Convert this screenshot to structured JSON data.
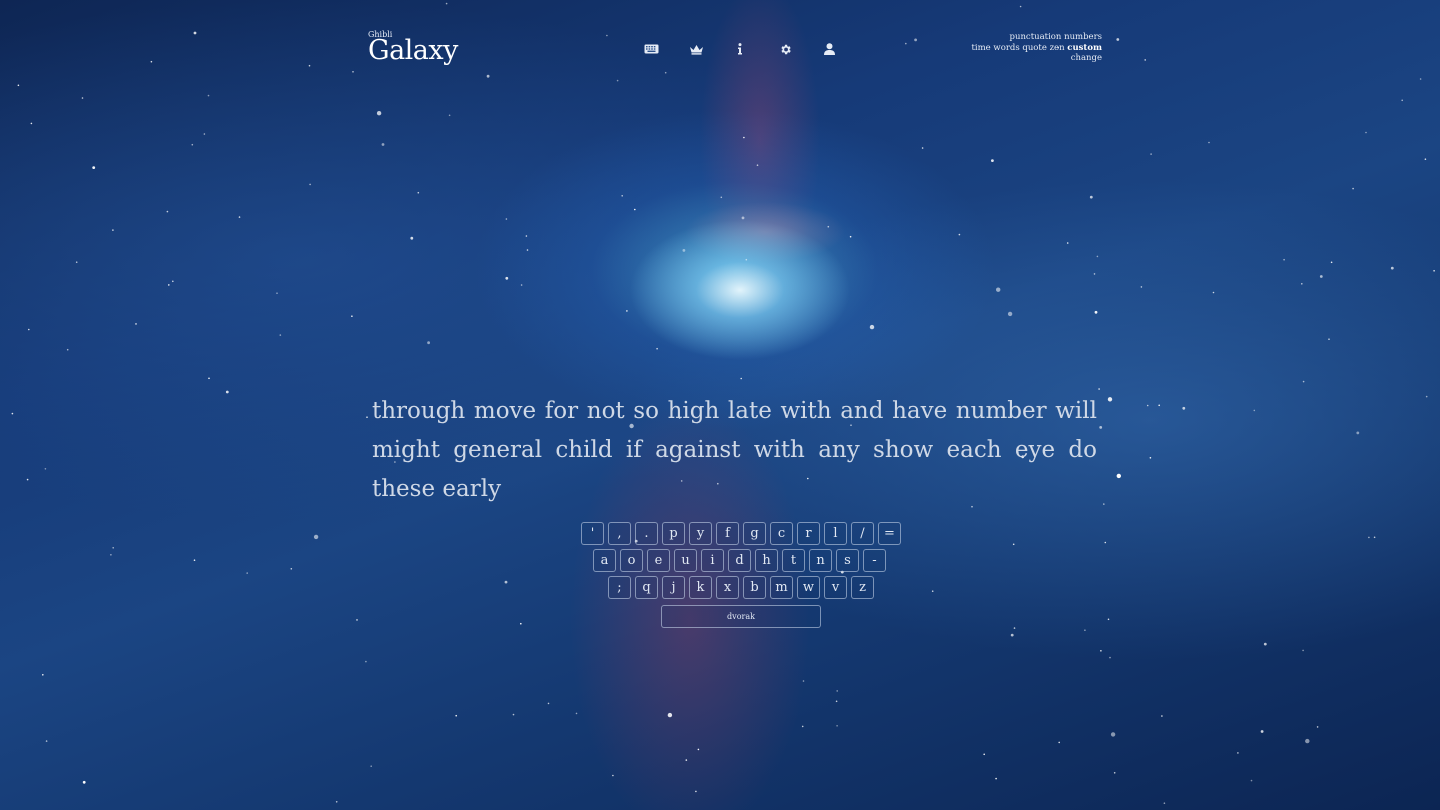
{
  "logo": {
    "sub": "Ghibli",
    "main": "Galaxy"
  },
  "nav": [
    {
      "icon": "keyboard-icon"
    },
    {
      "icon": "crown-icon"
    },
    {
      "icon": "info-icon"
    },
    {
      "icon": "gear-icon"
    },
    {
      "icon": "user-icon"
    }
  ],
  "config": {
    "row1": [
      "punctuation",
      "numbers"
    ],
    "row2": [
      "time",
      "words",
      "quote",
      "zen",
      "custom"
    ],
    "active": "custom",
    "change_label": "change"
  },
  "test": {
    "words": "through move for not so high late with and have number will might general child if against with any show each eye do these early"
  },
  "keymap": {
    "row1": [
      "'",
      ",",
      ".",
      "p",
      "y",
      "f",
      "g",
      "c",
      "r",
      "l",
      "/",
      "="
    ],
    "row2": [
      "a",
      "o",
      "e",
      "u",
      "i",
      "d",
      "h",
      "t",
      "n",
      "s",
      "-"
    ],
    "row3": [
      ";",
      "q",
      "j",
      "k",
      "x",
      "b",
      "m",
      "w",
      "v",
      "z"
    ],
    "layout_name": "dvorak"
  },
  "colors": {
    "text": "#cfd8e6",
    "main": "#ffffff",
    "background": "#163a78"
  }
}
